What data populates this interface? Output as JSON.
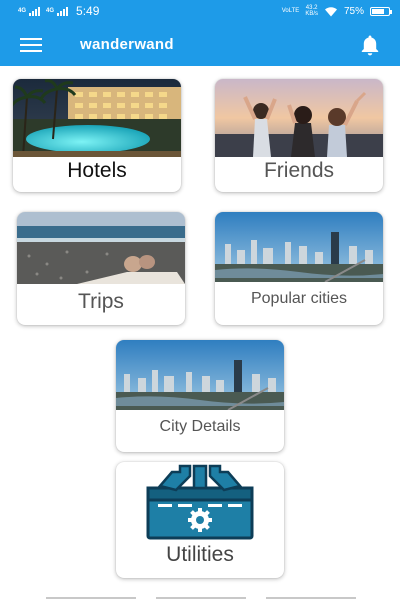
{
  "status_bar": {
    "network_1": "4G",
    "network_2": "4G",
    "time": "5:49",
    "speed_value": "43.2",
    "speed_unit": "KB/s",
    "battery": "75%",
    "battery_level": 0.75
  },
  "app_bar": {
    "title": "wanderwand",
    "menu_icon": "hamburger-menu-icon",
    "notification_icon": "bell-icon"
  },
  "cards": {
    "hotels": {
      "label": "Hotels",
      "image": "hotel-pool-photo"
    },
    "friends": {
      "label": "Friends",
      "image": "friends-photo"
    },
    "trips": {
      "label": "Trips",
      "image": "beach-photo"
    },
    "popular_cities": {
      "label": "Popular cities",
      "image": "city-skyline-photo"
    },
    "city_details": {
      "label": "City Details",
      "image": "city-skyline-photo"
    },
    "utilities": {
      "label": "Utilities",
      "image": "toolbox-icon"
    }
  },
  "colors": {
    "primary": "#1e9be8",
    "toolbox": "#1e7fa6",
    "toolbox_dark": "#0d3d57"
  }
}
